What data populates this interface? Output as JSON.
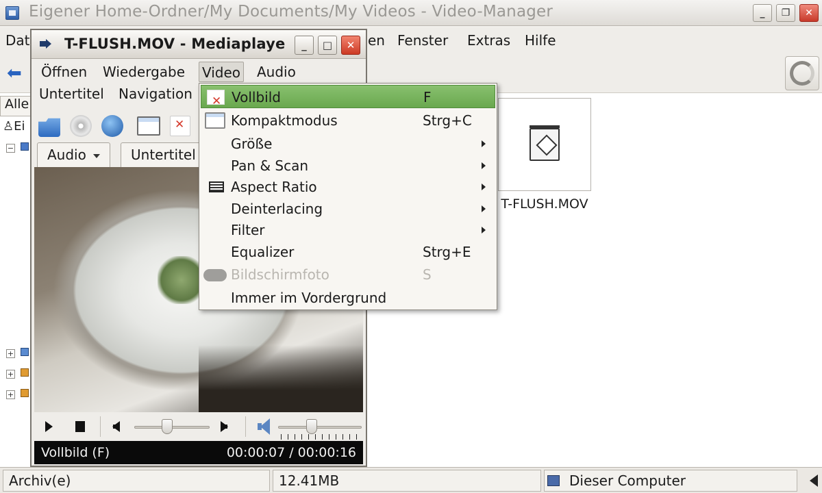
{
  "bg_window": {
    "title": "Eigener Home-Ordner/My Documents/My Videos - Video-Manager",
    "menu": [
      "Dat",
      "en",
      "Fenster",
      "Extras",
      "Hilfe"
    ],
    "sidebar_tab": "Alle",
    "sidebar_row": "Ei",
    "file": {
      "name": "T-FLUSH.MOV"
    },
    "status": {
      "left": "Archiv(e)",
      "size": "12.41MB",
      "location": "Dieser Computer"
    }
  },
  "mediaplayer": {
    "title": "T-FLUSH.MOV - Mediaplaye",
    "menu_row1": [
      "Öffnen",
      "Wiedergabe",
      "Video",
      "Audio"
    ],
    "menu_row2": [
      "Untertitel",
      "Navigation"
    ],
    "tabs": {
      "audio": "Audio",
      "subtitles": "Untertitel"
    },
    "status_left": "Vollbild (F)",
    "time": "00:00:07 / 00:00:16",
    "seek_fraction": 0.44,
    "volume_fraction": 0.4
  },
  "video_menu": {
    "items": [
      {
        "label": "Vollbild",
        "shortcut": "F",
        "icon": "fullscreen-icon",
        "highlighted": true
      },
      {
        "label": "Kompaktmodus",
        "shortcut": "Strg+C",
        "icon": "compact-mode-icon"
      },
      {
        "label": "Größe",
        "submenu": true
      },
      {
        "label": "Pan & Scan",
        "submenu": true
      },
      {
        "label": "Aspect Ratio",
        "submenu": true,
        "icon": "aspect-ratio-icon"
      },
      {
        "label": "Deinterlacing",
        "submenu": true
      },
      {
        "label": "Filter",
        "submenu": true
      },
      {
        "label": "Equalizer",
        "shortcut": "Strg+E"
      },
      {
        "label": "Bildschirmfoto",
        "shortcut": "S",
        "icon": "snapshot-icon",
        "disabled": true
      },
      {
        "label": "Immer im Vordergrund"
      }
    ]
  },
  "colors": {
    "menu_highlight": "#6aa84f",
    "close_button": "#cc3a24",
    "status_bar_bg": "#0a0a0a"
  }
}
